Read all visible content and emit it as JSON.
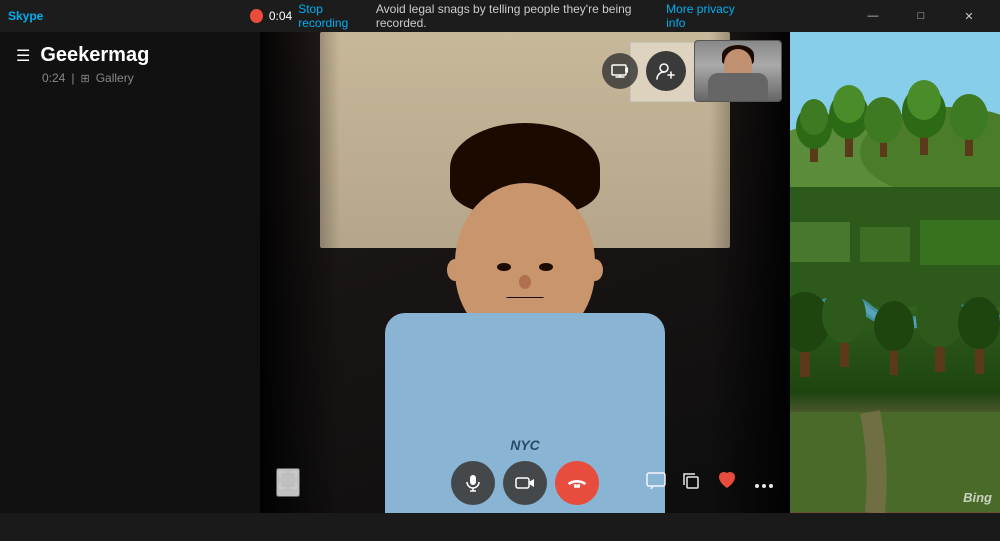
{
  "app": {
    "title": "Skype",
    "titlebar_buttons": {
      "minimize": "—",
      "maximize": "□",
      "close": "✕"
    }
  },
  "recording": {
    "dot_color": "#e74c3c",
    "time": "0:04",
    "stop_label": "Stop recording",
    "notification": "Avoid legal snags by telling people they're being recorded.",
    "privacy_link": "More privacy info"
  },
  "sidebar": {
    "menu_icon": "☰",
    "contact_name": "Geekermag",
    "call_duration": "0:24",
    "gallery_label": "Gallery"
  },
  "video": {
    "shirt_text": "NYC"
  },
  "controls": {
    "mute_label": "Mute",
    "camera_label": "Camera",
    "end_call_label": "End call",
    "chat_label": "Chat",
    "copy_label": "Copy",
    "react_label": "React",
    "more_label": "More"
  },
  "bing": {
    "watermark": "Bing"
  }
}
